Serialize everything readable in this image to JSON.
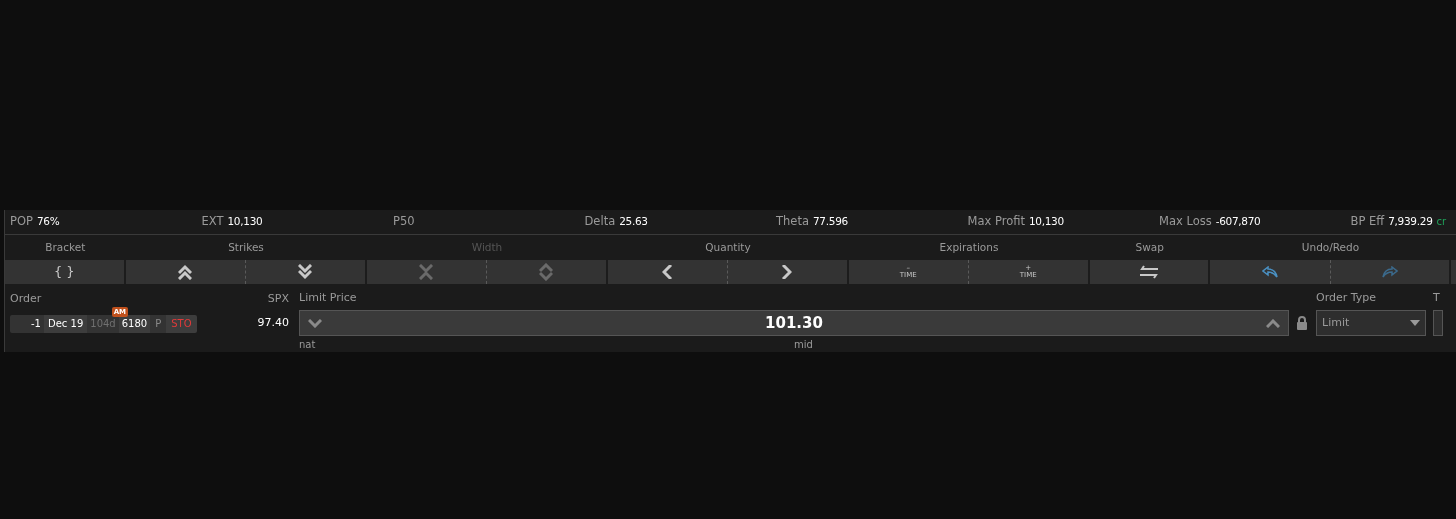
{
  "stats": [
    {
      "label": "POP",
      "value": "76%"
    },
    {
      "label": "EXT",
      "value": "10,130"
    },
    {
      "label": "P50"
    },
    {
      "label": "Delta",
      "value": "25.63"
    },
    {
      "label": "Theta",
      "value": "77.596"
    },
    {
      "label": "Max Profit",
      "value": "10,130"
    },
    {
      "label": "Max Loss",
      "value": "-607,870"
    },
    {
      "label": "BP Eff",
      "value": "7,939.29",
      "suffix": "cr"
    }
  ],
  "groups": [
    {
      "label": "Bracket",
      "disabled": false,
      "buttons": [
        {
          "kind": "bracket",
          "text": "{ }"
        }
      ]
    },
    {
      "label": "Strikes",
      "disabled": false,
      "buttons": [
        {
          "kind": "double-up"
        },
        {
          "kind": "double-down"
        }
      ]
    },
    {
      "label": "Width",
      "disabled": true,
      "buttons": [
        {
          "kind": "narrow"
        },
        {
          "kind": "widen"
        }
      ]
    },
    {
      "label": "Quantity",
      "disabled": false,
      "buttons": [
        {
          "kind": "left"
        },
        {
          "kind": "right"
        }
      ]
    },
    {
      "label": "Expirations",
      "disabled": false,
      "buttons": [
        {
          "kind": "time",
          "sign": "–",
          "text": "TIME"
        },
        {
          "kind": "time",
          "sign": "+",
          "text": "TIME"
        }
      ]
    },
    {
      "label": "Swap",
      "disabled": false,
      "buttons": [
        {
          "kind": "swap"
        }
      ]
    },
    {
      "label": "Undo/Redo",
      "disabled": false,
      "buttons": [
        {
          "kind": "undo"
        },
        {
          "kind": "redo"
        }
      ]
    }
  ],
  "order": {
    "label": "Order",
    "leg": {
      "quantity": "-1",
      "expiration": "Dec 19",
      "days": "104d",
      "session": "AM",
      "strike": "6180",
      "type": "P",
      "action": "STO"
    },
    "underlying": "SPX",
    "price": "97.40"
  },
  "limit_price": {
    "label": "Limit Price",
    "value": "101.30",
    "locked": true,
    "left_hint": "nat",
    "center_hint": "mid"
  },
  "order_type": {
    "label": "Order Type",
    "value": "Limit"
  },
  "cut_column": {
    "label": "T"
  }
}
